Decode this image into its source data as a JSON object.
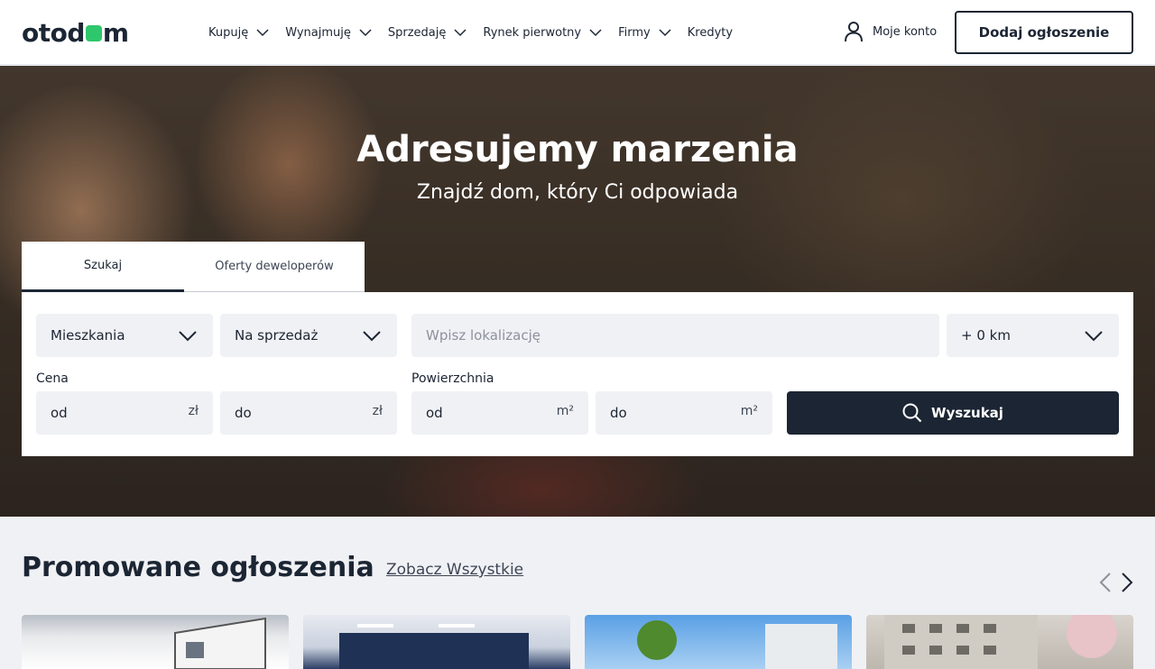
{
  "brand": {
    "logo_left": "otod",
    "logo_right": "m",
    "accent": "#2ec76b",
    "primary": "#1c2533"
  },
  "nav": {
    "items": [
      {
        "label": "Kupuję",
        "dropdown": true
      },
      {
        "label": "Wynajmuję",
        "dropdown": true
      },
      {
        "label": "Sprzedaję",
        "dropdown": true
      },
      {
        "label": "Rynek pierwotny",
        "dropdown": true
      },
      {
        "label": "Firmy",
        "dropdown": true
      },
      {
        "label": "Kredyty",
        "dropdown": false
      }
    ],
    "account_label": "Moje konto",
    "add_listing_label": "Dodaj ogłoszenie"
  },
  "hero": {
    "title": "Adresujemy marzenia",
    "subtitle": "Znajdź dom, który Ci odpowiada"
  },
  "search": {
    "tabs": [
      {
        "label": "Szukaj",
        "active": true
      },
      {
        "label": "Oferty deweloperów",
        "active": false
      }
    ],
    "property_type": "Mieszkania",
    "transaction_type": "Na sprzedaż",
    "location_placeholder": "Wpisz lokalizację",
    "radius": "+ 0 km",
    "price_label": "Cena",
    "price_from": "od",
    "price_to": "do",
    "price_unit": "zł",
    "area_label": "Powierzchnia",
    "area_from": "od",
    "area_to": "do",
    "area_unit": "m²",
    "submit_label": "Wyszukaj"
  },
  "promoted": {
    "title": "Promowane ogłoszenia",
    "see_all_label": "Zobacz Wszystkie"
  }
}
